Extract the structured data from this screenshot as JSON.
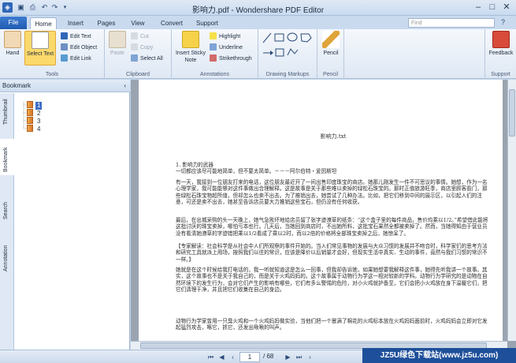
{
  "window": {
    "title": "影响力.pdf - Wondershare PDF Editor"
  },
  "tabs": [
    "Home",
    "Insert",
    "Pages",
    "View",
    "Convert",
    "Support"
  ],
  "file_label": "File",
  "find_placeholder": "Find",
  "ribbon": {
    "tools": {
      "label": "Tools",
      "hand": "Hand",
      "select_text": "Select Text",
      "edit_text": "Edit Text",
      "edit_object": "Edit Object",
      "edit_link": "Edit Link"
    },
    "clipboard": {
      "label": "Clipboard",
      "paste": "Paste",
      "cut": "Cut",
      "copy": "Copy",
      "select_all": "Select All"
    },
    "annotations": {
      "label": "Annotations",
      "insert_sticky_note": "Insert Sticky Note",
      "highlight": "Highlight",
      "underline": "Underline",
      "strikethrough": "Strikethrough"
    },
    "drawing": {
      "label": "Drawing Markups"
    },
    "pencil": {
      "label": "Pencil",
      "button": "Pencil"
    },
    "support": {
      "label": "Support",
      "feedback": "Feedback"
    }
  },
  "sidebar": {
    "title": "Bookmark",
    "vtabs": [
      "Thumbnail",
      "Bookmark",
      "Search",
      "Annotation"
    ],
    "bookmarks": [
      "1",
      "2",
      "3",
      "4"
    ]
  },
  "document": {
    "heading": "影响力.txt",
    "paragraphs": [
      "1. 影响力的武器\n一切都应该尽可能地简单，但不要太简单。－－－阿尔伯特・爱因斯坦",
      "有一天，我接到一位朋友打来的电话，这位朋友最近开了一间出售印度珠宝的商店。她那儿刚发生一件不可思议的事情。她想，作为一名心理学家，我可能能够对这件事做出合理解释。这是故事是关于那些难以卖掉的绿松石珠宝的。那时正值旅游旺季，商店里顾客盈门，那些绿松石珠宝物超所值，但却怎么也卖不出去。为了推销出去，她尝试了几种办法。比如，把它们移到中间的展示区，以引起人们的注意，可还是卖不出去，她甚至告诉店员要大力推销这些宝石，但仍没有任何收获。",
      "最后，在出城采购的头一天晚上，她气急败坏地给店员留了张字迹潦草的纸条：“这个盒子里的每件商品，售价均乘以1/2。”希望借此能将这批讨厌的珠宝卖掉，哪怕亏本也行。几天后，当她回到商店时，不出她所料，这批宝石果然全都被卖掉了。然而，当她得知由于营业员没有看清她潦草的字迹错把乘以1/2看成了乘以2时，而以2倍的价格将全部珠宝卖掉之后，她惊呆了。",
      "【专家解读：社会科学是从社会中人们所观察的事件开始的。当人们常见事物的发展与大众习惯的发展并不吻合时，科学家们的思考方法和研究工具就派上用场，按照我们以往的常识，应该是降价以后销量才会好，但现实生活中真实、生动的事件，竟然与我们习惯的常识不一样。】",
      "她就是在这个时候给我打电话的，我一听就知道这是怎么一回事，但我却告诉她，如果她想要我解释这件事，她得先听我讲一个故事。其实，这个故事也不是关于我自己的，而是关于火鸡妈妈的。这个故事属于动物行为学这一相对较新的学科。动物行为学研究的是动物在自然环境下的发生行为，会对它们产生的影响有哪些，它们有多么警惕的危险，对小火鸡就护备至，它们会把小火鸡放在身下温暖它们，把它们清理干净，并且把它们收集在自己的身边。",
      "动物行为学家曾用一只臭火鸡和一个火鸡妈妈做实验，当他们把一个塞满了棉花的火鸡标本放在火鸡妈妈面前时，火鸡妈妈会立即对它发起猛烈攻击，啄它，抓它，还发出啾啾的叫声。"
    ]
  },
  "status": {
    "page_current": "1",
    "page_total": "/ 68"
  },
  "watermark": "JZ5U绿色下载站(www.jz5u.com)"
}
